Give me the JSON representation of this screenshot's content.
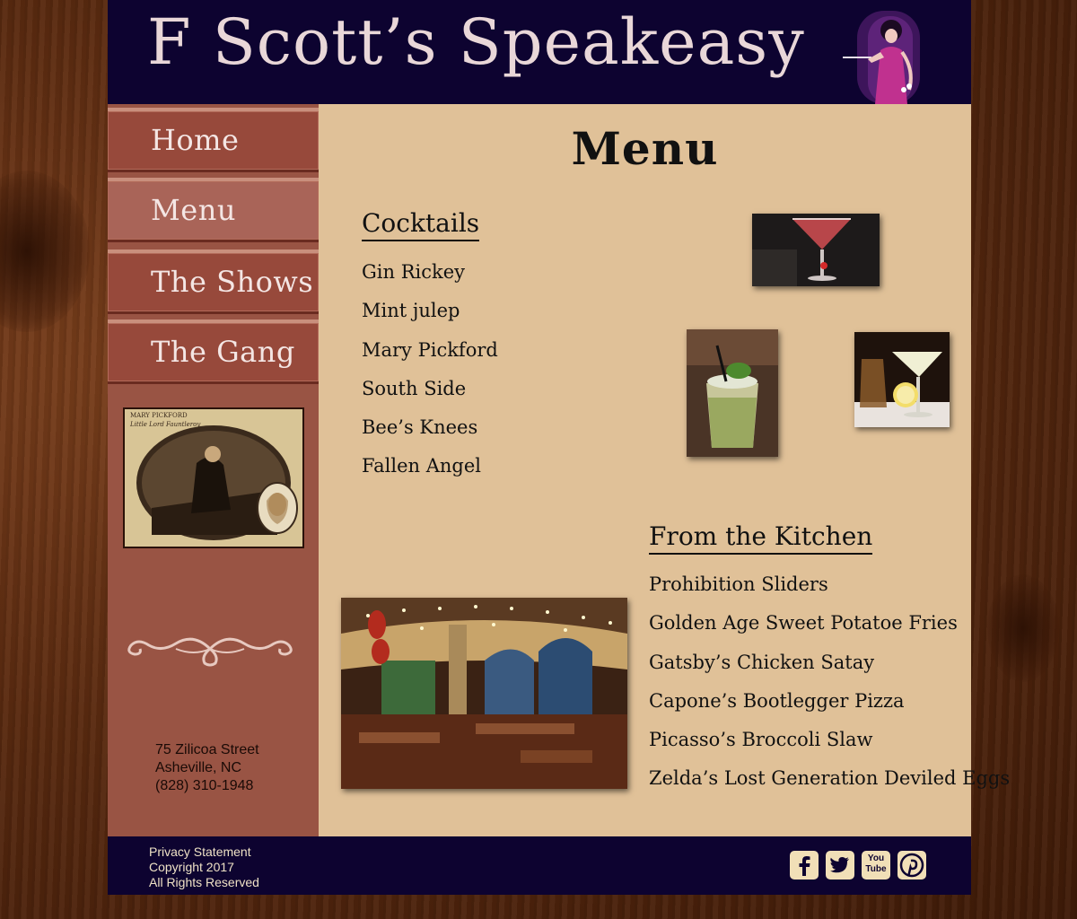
{
  "header": {
    "site_title": "F Scott’s Speakeasy"
  },
  "nav": [
    {
      "label": "Home"
    },
    {
      "label": "Menu"
    },
    {
      "label": "The Shows"
    },
    {
      "label": "The Gang"
    }
  ],
  "sidebar": {
    "poster_caption": "Mary Pickford",
    "poster_subcaption": "Little Lord Fauntleroy",
    "address": {
      "street": "75 Zilicoa Street",
      "city": "Asheville, NC",
      "phone": "(828) 310-1948"
    }
  },
  "main": {
    "title": "Menu",
    "cocktails": {
      "heading": "Cocktails",
      "items": [
        "Gin Rickey",
        "Mint julep",
        "Mary Pickford",
        "South Side",
        "Bee’s Knees",
        "Fallen Angel"
      ]
    },
    "kitchen": {
      "heading": "From the Kitchen",
      "items": [
        "Prohibition Sliders",
        "Golden Age Sweet Potatoe Fries",
        "Gatsby’s Chicken Satay",
        "Capone’s Bootlegger Pizza",
        "Picasso’s Broccoli Slaw",
        "Zelda’s Lost Generation Deviled Eggs"
      ]
    }
  },
  "footer": {
    "privacy": "Privacy Statement",
    "copyright": "Copyright 2017",
    "rights": "All Rights Reserved",
    "socials": [
      "facebook-icon",
      "twitter-icon",
      "youtube-icon",
      "pinterest-icon"
    ],
    "youtube_label": "You Tube"
  },
  "colors": {
    "header_bg": "#0d0330",
    "sidebar_bg": "#995444",
    "nav_bg": "#97493b",
    "content_bg": "#e0c198",
    "title_text": "#e9d7d8"
  }
}
